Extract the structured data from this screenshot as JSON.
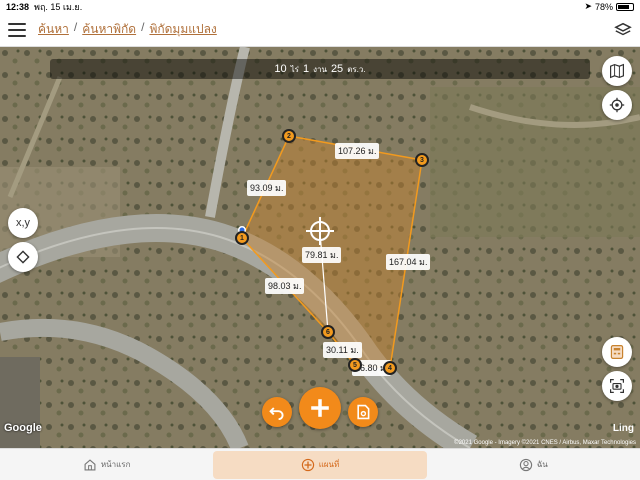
{
  "status": {
    "time": "12:38",
    "date": "พฤ. 15 เม.ย.",
    "battery": "78%",
    "battery_level": 0.78
  },
  "nav": {
    "breadcrumbs": [
      "ค้นหา",
      "ค้นหาพิกัด",
      "พิกัดมุมแปลง"
    ]
  },
  "area": {
    "rai": "10",
    "rai_unit": "ไร่",
    "ngan": "1",
    "ngan_unit": "งาน",
    "wah": "25",
    "wah_unit": "ตร.ว."
  },
  "map_controls": {
    "xy_label": "x,y"
  },
  "measurements": {
    "d12": "93.09 ม.",
    "d23": "107.26 ม.",
    "d34": "167.04 ม.",
    "d45": "26.80 ม.",
    "d56": "30.11 ม.",
    "d61": "98.03 ม.",
    "center": "79.81 ม."
  },
  "vertices": [
    "1",
    "2",
    "3",
    "4",
    "5",
    "6"
  ],
  "map_branding": {
    "google": "Google",
    "ling": "Ling",
    "attribution": "©2021 Google - Imagery ©2021 CNES / Airbus, Maxar Technologies"
  },
  "tabs": [
    {
      "label": "หน้าแรก",
      "icon": "home-icon"
    },
    {
      "label": "แผนที่",
      "icon": "add-circle-icon"
    },
    {
      "label": "ฉัน",
      "icon": "user-icon"
    }
  ],
  "colors": {
    "accent": "#f28a1a",
    "polygon_fill": "#c8822e",
    "polygon_stroke": "#f29a1e"
  }
}
